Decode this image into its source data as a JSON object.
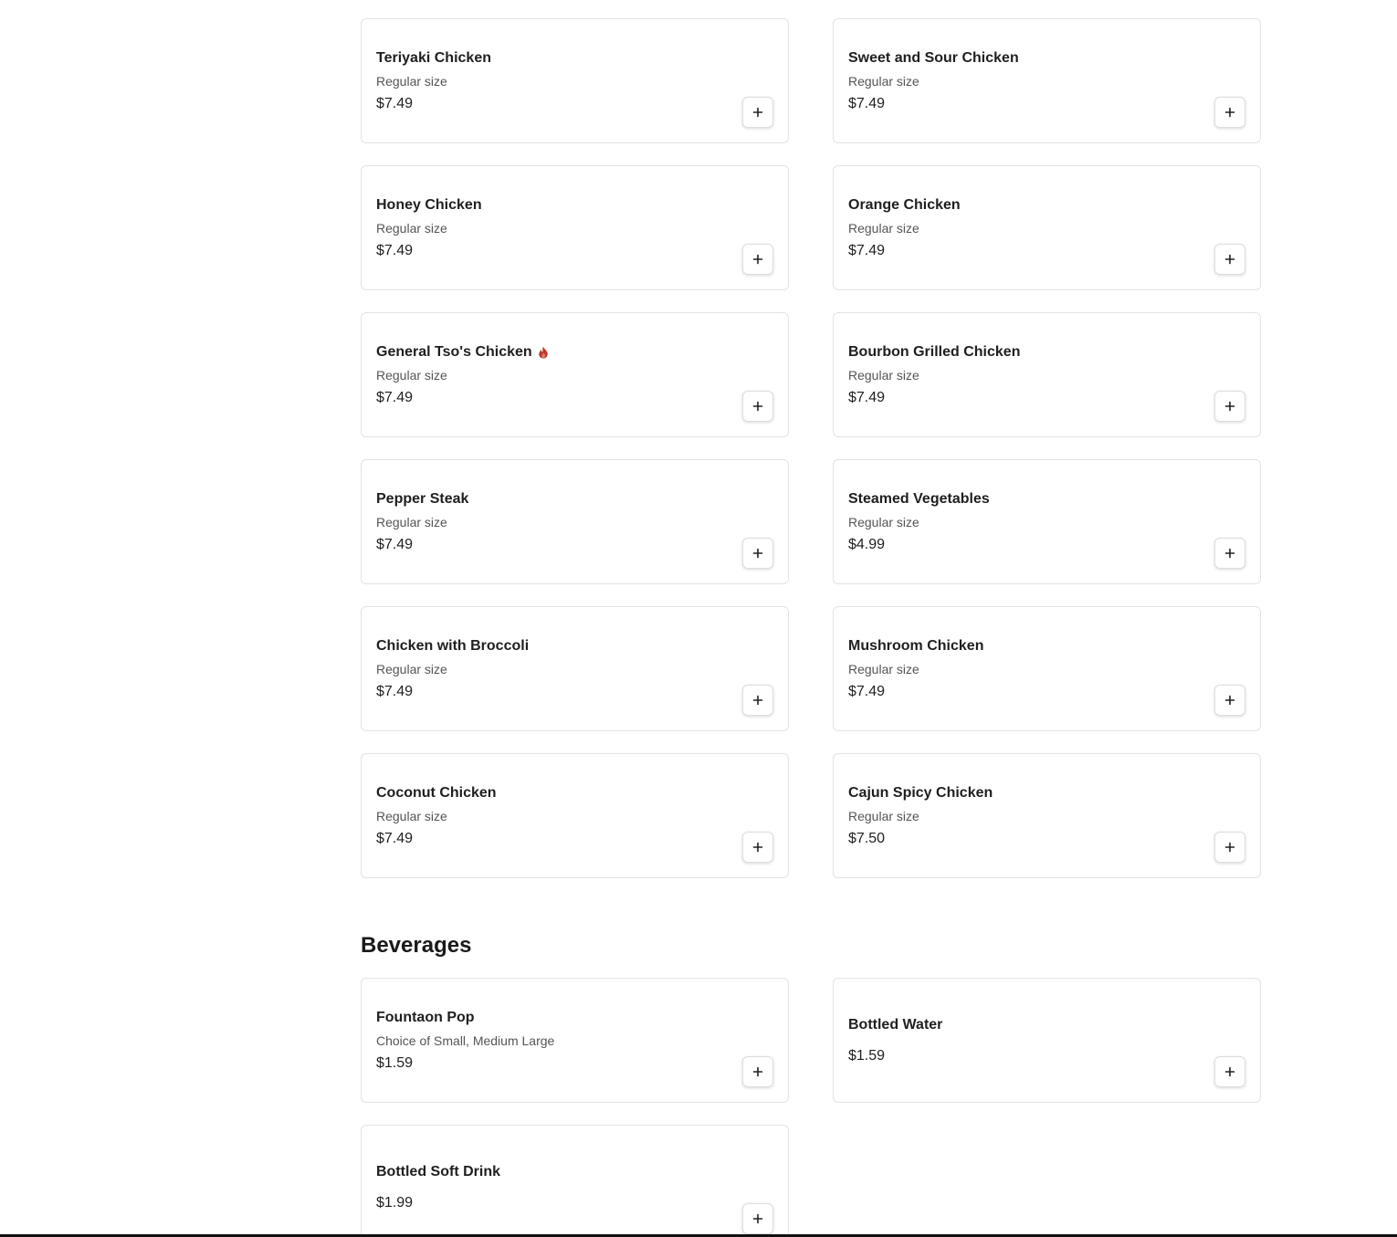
{
  "colors": {
    "spicy_icon": "#c0392b",
    "card_border": "#e3e3e3",
    "text": "#1a1a1a"
  },
  "menu_items": [
    {
      "name": "Teriyaki Chicken",
      "desc": "Regular size",
      "price": "$7.49",
      "add_icon": "plus-icon"
    },
    {
      "name": "Sweet and Sour Chicken",
      "desc": "Regular size",
      "price": "$7.49",
      "add_icon": "plus-icon"
    },
    {
      "name": "Honey Chicken",
      "desc": "Regular size",
      "price": "$7.49",
      "add_icon": "plus-icon"
    },
    {
      "name": "Orange Chicken",
      "desc": "Regular size",
      "price": "$7.49",
      "add_icon": "plus-icon"
    },
    {
      "name": "General Tso's Chicken",
      "desc": "Regular size",
      "price": "$7.49",
      "spicy_icon": "flame-icon",
      "add_icon": "plus-icon"
    },
    {
      "name": "Bourbon Grilled Chicken",
      "desc": "Regular size",
      "price": "$7.49",
      "add_icon": "plus-icon"
    },
    {
      "name": "Pepper Steak",
      "desc": "Regular size",
      "price": "$7.49",
      "add_icon": "plus-icon"
    },
    {
      "name": "Steamed Vegetables",
      "desc": "Regular size",
      "price": "$4.99",
      "add_icon": "plus-icon"
    },
    {
      "name": "Chicken with Broccoli",
      "desc": "Regular size",
      "price": "$7.49",
      "add_icon": "plus-icon"
    },
    {
      "name": "Mushroom Chicken",
      "desc": "Regular size",
      "price": "$7.49",
      "add_icon": "plus-icon"
    },
    {
      "name": "Coconut Chicken",
      "desc": "Regular size",
      "price": "$7.49",
      "add_icon": "plus-icon"
    },
    {
      "name": "Cajun Spicy Chicken",
      "desc": "Regular size",
      "price": "$7.50",
      "add_icon": "plus-icon"
    }
  ],
  "beverages": {
    "title": "Beverages",
    "items": [
      {
        "name": "Fountaon Pop",
        "desc": "Choice of Small, Medium Large",
        "price": "$1.59",
        "add_icon": "plus-icon"
      },
      {
        "name": "Bottled Water",
        "price": "$1.59",
        "add_icon": "plus-icon"
      },
      {
        "name": "Bottled Soft Drink",
        "price": "$1.99",
        "add_icon": "plus-icon"
      }
    ]
  }
}
